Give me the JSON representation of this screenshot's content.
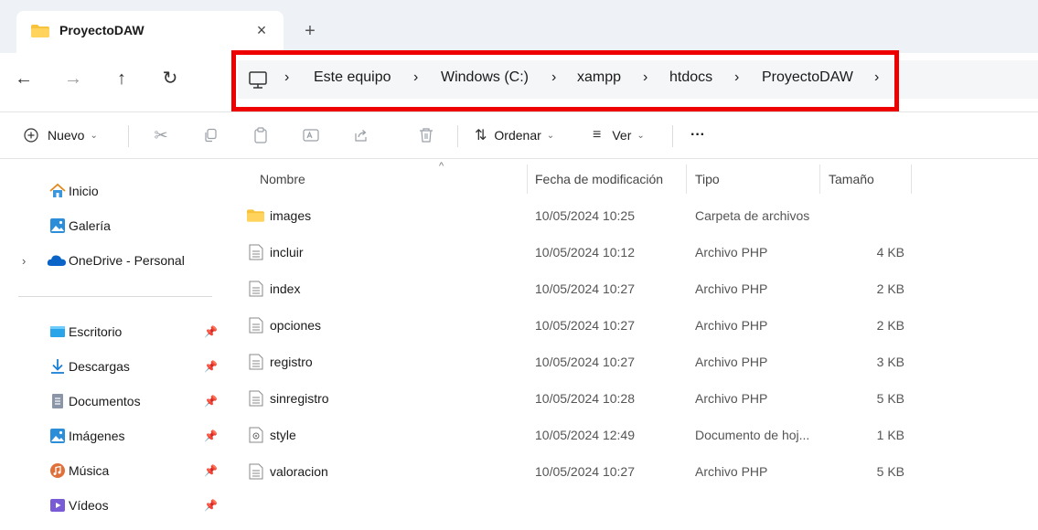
{
  "tab": {
    "title": "ProyectoDAW",
    "close_symbol": "×",
    "new_tab_symbol": "+"
  },
  "nav": {
    "back": "←",
    "forward": "→",
    "up": "↑",
    "refresh": "↻"
  },
  "breadcrumb": {
    "separator": "›",
    "items": [
      "Este equipo",
      "Windows (C:)",
      "xampp",
      "htdocs",
      "ProyectoDAW"
    ]
  },
  "toolbar": {
    "new_label": "Nuevo",
    "sort_label": "Ordenar",
    "view_label": "Ver",
    "more_label": "···"
  },
  "sidebar": {
    "home": "Inicio",
    "gallery": "Galería",
    "onedrive": "OneDrive - Personal",
    "quick_access": [
      {
        "label": "Escritorio",
        "icon": "desktop-icon"
      },
      {
        "label": "Descargas",
        "icon": "downloads-icon"
      },
      {
        "label": "Documentos",
        "icon": "documents-icon"
      },
      {
        "label": "Imágenes",
        "icon": "pictures-icon"
      },
      {
        "label": "Música",
        "icon": "music-icon"
      },
      {
        "label": "Vídeos",
        "icon": "videos-icon"
      }
    ]
  },
  "columns": {
    "name": "Nombre",
    "modified": "Fecha de modificación",
    "type": "Tipo",
    "size": "Tamaño"
  },
  "files": [
    {
      "name": "images",
      "modified": "10/05/2024 10:25",
      "type": "Carpeta de archivos",
      "size": "",
      "icon": "folder-icon"
    },
    {
      "name": "incluir",
      "modified": "10/05/2024 10:12",
      "type": "Archivo PHP",
      "size": "4 KB",
      "icon": "file-icon"
    },
    {
      "name": "index",
      "modified": "10/05/2024 10:27",
      "type": "Archivo PHP",
      "size": "2 KB",
      "icon": "file-icon"
    },
    {
      "name": "opciones",
      "modified": "10/05/2024 10:27",
      "type": "Archivo PHP",
      "size": "2 KB",
      "icon": "file-icon"
    },
    {
      "name": "registro",
      "modified": "10/05/2024 10:27",
      "type": "Archivo PHP",
      "size": "3 KB",
      "icon": "file-icon"
    },
    {
      "name": "sinregistro",
      "modified": "10/05/2024 10:28",
      "type": "Archivo PHP",
      "size": "5 KB",
      "icon": "file-icon"
    },
    {
      "name": "style",
      "modified": "10/05/2024 12:49",
      "type": "Documento de hoj...",
      "size": "1 KB",
      "icon": "stylesheet-icon"
    },
    {
      "name": "valoracion",
      "modified": "10/05/2024 10:27",
      "type": "Archivo PHP",
      "size": "5 KB",
      "icon": "file-icon"
    }
  ],
  "colors": {
    "accent": "#0067c0",
    "highlight": "#ee0000",
    "folder": "#f8c33c",
    "tabstrip": "#eef1f6"
  }
}
